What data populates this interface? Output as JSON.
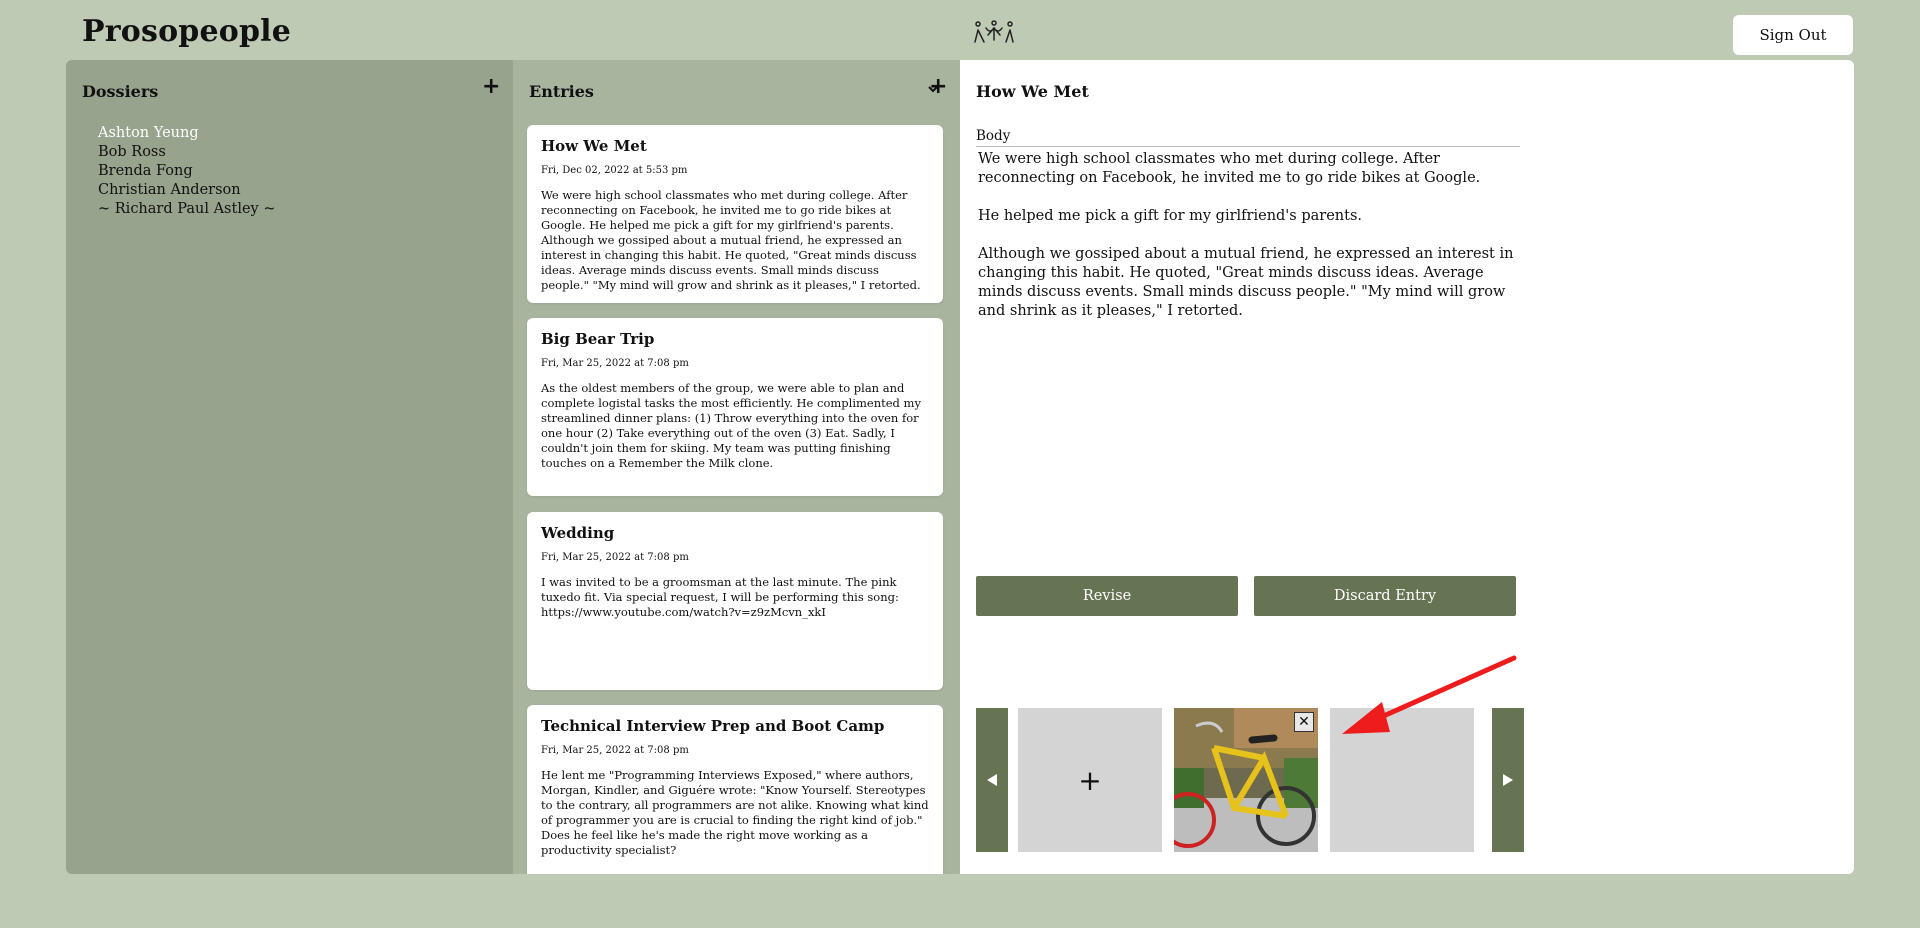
{
  "app": {
    "title": "Prosopeople",
    "signout_label": "Sign Out"
  },
  "dossiers": {
    "header": "Dossiers",
    "add_icon": "plus-icon",
    "items": [
      {
        "label": "Ashton Yeung",
        "active": true
      },
      {
        "label": "Bob Ross",
        "active": false
      },
      {
        "label": "Brenda Fong",
        "active": false
      },
      {
        "label": "Christian Anderson",
        "active": false
      },
      {
        "label": "~ Richard Paul Astley ~",
        "active": false
      }
    ]
  },
  "entries": {
    "header": "Entries",
    "sort_icon": "chevron-down-icon",
    "add_icon": "plus-icon",
    "items": [
      {
        "title": "How We Met",
        "date": "Fri, Dec 02, 2022 at 5:53 pm",
        "body": "We were high school classmates who met during college. After reconnecting on Facebook, he invited me to go ride bikes at Google. He helped me pick a gift for my girlfriend's parents. Although we gossiped about a mutual friend, he expressed an interest in changing this habit. He quoted, \"Great minds discuss ideas. Average minds discuss events. Small minds discuss people.\" \"My mind will grow and shrink as it pleases,\" I retorted."
      },
      {
        "title": "Big Bear Trip",
        "date": "Fri, Mar 25, 2022 at 7:08 pm",
        "body": "As the oldest members of the group, we were able to plan and complete logistal tasks the most efficiently. He complimented my streamlined dinner plans: (1) Throw everything into the oven for one hour (2) Take everything out of the oven (3) Eat. Sadly, I couldn't join them for skiing. My team was putting finishing touches on a Remember the Milk clone."
      },
      {
        "title": "Wedding",
        "date": "Fri, Mar 25, 2022 at 7:08 pm",
        "body": "I was invited to be a groomsman at the last minute. The pink tuxedo fit. Via special request, I will be performing this song: https://www.youtube.com/watch?v=z9zMcvn_xkI"
      },
      {
        "title": "Technical Interview Prep and Boot Camp",
        "date": "Fri, Mar 25, 2022 at 7:08 pm",
        "body": "He lent me \"Programming Interviews Exposed,\" where authors, Morgan, Kindler, and Giguére wrote: \"Know Yourself. Stereotypes to the contrary, all programmers are not alike. Knowing what kind of programmer you are is crucial to finding the right kind of job.\" Does he feel like he's made the right move working as a productivity specialist?"
      }
    ]
  },
  "detail": {
    "title": "How We Met",
    "body_label": "Body",
    "body_text": "We were high school classmates who met during college. After reconnecting on Facebook, he invited me to go ride bikes at Google.\n\nHe helped me pick a gift for my girlfriend's parents.\n\nAlthough we gossiped about a mutual friend, he expressed an interest in changing this habit. He quoted, \"Great minds discuss ideas. Average minds discuss events. Small minds discuss people.\" \"My mind will grow and shrink as it pleases,\" I retorted.",
    "revise_label": "Revise",
    "discard_label": "Discard Entry",
    "carousel": {
      "add_symbol": "+",
      "close_symbol": "✕",
      "prev_icon": "triangle-left-icon",
      "next_icon": "triangle-right-icon"
    }
  },
  "colors": {
    "background": "#bfcab5",
    "dossiers_panel": "#97a38c",
    "entries_panel": "#a8b49e",
    "button": "#667453",
    "annotation_arrow": "#ee1c1c"
  }
}
